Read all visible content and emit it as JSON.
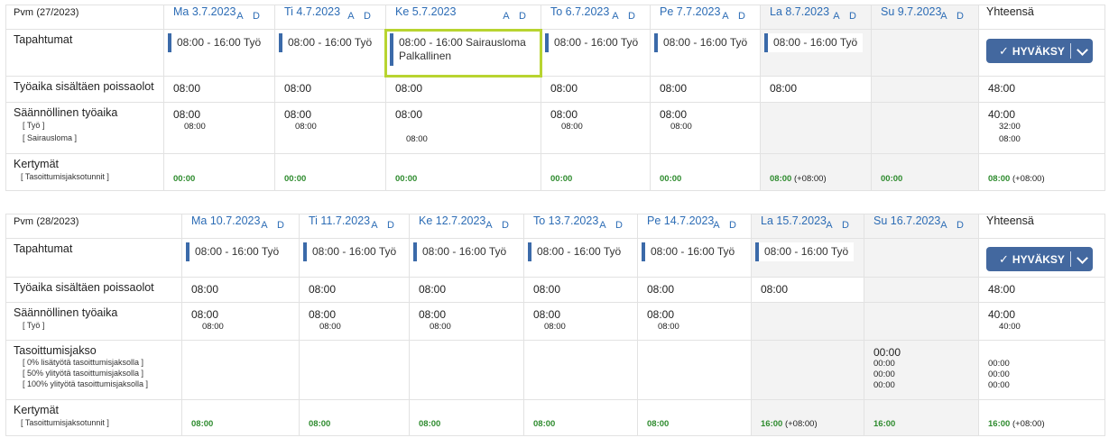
{
  "weeks": [
    {
      "pvm_label": "Pvm",
      "week": "(27/2023)",
      "ad_label": "A D",
      "days": [
        "Ma 3.7.2023",
        "Ti 4.7.2023",
        "Ke 5.7.2023",
        "To 6.7.2023",
        "Pe 7.7.2023",
        "La 8.7.2023",
        "Su 9.7.2023"
      ],
      "total_label": "Yhteensä",
      "events_label": "Tapahtumat",
      "events": [
        {
          "line1": "08:00 - 16:00 Työ",
          "line2": ""
        },
        {
          "line1": "08:00 - 16:00 Työ",
          "line2": ""
        },
        {
          "line1": "08:00 - 16:00 Sairausloma",
          "line2": "Palkallinen"
        },
        {
          "line1": "08:00 - 16:00 Työ",
          "line2": ""
        },
        {
          "line1": "08:00 - 16:00 Työ",
          "line2": ""
        },
        {
          "line1": "08:00 - 16:00 Työ",
          "line2": ""
        },
        null
      ],
      "approve_label": "HYVÄKSY",
      "worktime_label": "Työaika sisältäen poissaolot",
      "worktime": [
        "08:00",
        "08:00",
        "08:00",
        "08:00",
        "08:00",
        "08:00",
        "",
        "48:00"
      ],
      "regular_label": "Säännöllinen työaika",
      "regular_sublabels": [
        "[ Työ ]",
        "[ Sairausloma ]"
      ],
      "regular": [
        {
          "main": "08:00",
          "subs": [
            "08:00",
            ""
          ]
        },
        {
          "main": "08:00",
          "subs": [
            "08:00",
            ""
          ]
        },
        {
          "main": "08:00",
          "subs": [
            "",
            "08:00"
          ]
        },
        {
          "main": "08:00",
          "subs": [
            "08:00",
            ""
          ]
        },
        {
          "main": "08:00",
          "subs": [
            "08:00",
            ""
          ]
        },
        {
          "main": "",
          "subs": []
        },
        {
          "main": "",
          "subs": []
        },
        {
          "main": "40:00",
          "subs": [
            "32:00",
            "08:00"
          ]
        }
      ],
      "balance_label": "Kertymät",
      "balance_sublabel": "[ Tasoittumisjaksotunnit ]",
      "balance": [
        {
          "v": "00:00",
          "x": ""
        },
        {
          "v": "00:00",
          "x": ""
        },
        {
          "v": "00:00",
          "x": ""
        },
        {
          "v": "00:00",
          "x": ""
        },
        {
          "v": "00:00",
          "x": ""
        },
        {
          "v": "08:00",
          "x": "(+08:00)"
        },
        {
          "v": "00:00",
          "x": ""
        },
        {
          "v": "08:00",
          "x": "(+08:00)"
        }
      ]
    },
    {
      "pvm_label": "Pvm",
      "week": "(28/2023)",
      "ad_label": "A D",
      "days": [
        "Ma 10.7.2023",
        "Ti 11.7.2023",
        "Ke 12.7.2023",
        "To 13.7.2023",
        "Pe 14.7.2023",
        "La 15.7.2023",
        "Su 16.7.2023"
      ],
      "total_label": "Yhteensä",
      "events_label": "Tapahtumat",
      "events": [
        {
          "line1": "08:00 - 16:00 Työ",
          "line2": ""
        },
        {
          "line1": "08:00 - 16:00 Työ",
          "line2": ""
        },
        {
          "line1": "08:00 - 16:00 Työ",
          "line2": ""
        },
        {
          "line1": "08:00 - 16:00 Työ",
          "line2": ""
        },
        {
          "line1": "08:00 - 16:00 Työ",
          "line2": ""
        },
        {
          "line1": "08:00 - 16:00 Työ",
          "line2": ""
        },
        null
      ],
      "approve_label": "HYVÄKSY",
      "worktime_label": "Työaika sisältäen poissaolot",
      "worktime": [
        "08:00",
        "08:00",
        "08:00",
        "08:00",
        "08:00",
        "08:00",
        "",
        "48:00"
      ],
      "regular_label": "Säännöllinen työaika",
      "regular_sublabels": [
        "[ Työ ]"
      ],
      "regular": [
        {
          "main": "08:00",
          "subs": [
            "08:00"
          ]
        },
        {
          "main": "08:00",
          "subs": [
            "08:00"
          ]
        },
        {
          "main": "08:00",
          "subs": [
            "08:00"
          ]
        },
        {
          "main": "08:00",
          "subs": [
            "08:00"
          ]
        },
        {
          "main": "08:00",
          "subs": [
            "08:00"
          ]
        },
        {
          "main": "",
          "subs": []
        },
        {
          "main": "",
          "subs": []
        },
        {
          "main": "40:00",
          "subs": [
            "40:00"
          ]
        }
      ],
      "period_label": "Tasoittumisjakso",
      "period_sublabels": [
        "[ 0% lisätyötä tasoittumisjaksolla ]",
        "[ 50% ylityötä tasoittumisjaksolla ]",
        "[ 100% ylityötä tasoittumisjaksolla ]"
      ],
      "period": [
        null,
        null,
        null,
        null,
        null,
        null,
        {
          "main": "00:00",
          "subs": [
            "00:00",
            "00:00",
            "00:00"
          ]
        },
        {
          "main": "",
          "subs": [
            "00:00",
            "00:00",
            "00:00"
          ]
        }
      ],
      "balance_label": "Kertymät",
      "balance_sublabel": "[ Tasoittumisjaksotunnit ]",
      "balance": [
        {
          "v": "08:00",
          "x": ""
        },
        {
          "v": "08:00",
          "x": ""
        },
        {
          "v": "08:00",
          "x": ""
        },
        {
          "v": "08:00",
          "x": ""
        },
        {
          "v": "08:00",
          "x": ""
        },
        {
          "v": "16:00",
          "x": "(+08:00)"
        },
        {
          "v": "16:00",
          "x": ""
        },
        {
          "v": "16:00",
          "x": "(+08:00)"
        }
      ]
    }
  ],
  "colors": {
    "link": "#2c6cb5",
    "button": "#43689f",
    "selected_border": "#b8d430",
    "green": "#2e8b2e",
    "weekend_bg": "#f3f3f3"
  }
}
